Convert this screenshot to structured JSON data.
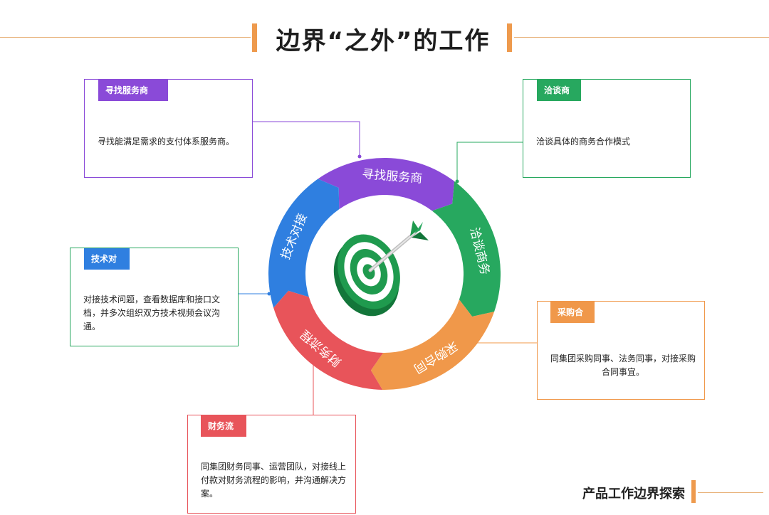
{
  "title": "边界“之外”的工作",
  "footer": "产品工作边界探索",
  "colors": {
    "accent": "#ee9a4d",
    "purple": "#8a4ad8",
    "green": "#27a85f",
    "orange": "#f0984a",
    "red": "#e8545a",
    "blue": "#2f7fe0",
    "target_green": "#1f9a4e"
  },
  "segments": [
    {
      "label": "寻找服务商",
      "color": "#8a4ad8"
    },
    {
      "label": "洽谈商务",
      "color": "#27a85f"
    },
    {
      "label": "采购合同",
      "color": "#f0984a"
    },
    {
      "label": "财务流程",
      "color": "#e8545a"
    },
    {
      "label": "技术对接",
      "color": "#2f7fe0"
    }
  ],
  "cards": [
    {
      "tag": "寻找服务商",
      "text": "寻找能满足需求的支付体系服务商。"
    },
    {
      "tag": "洽谈商务",
      "text": "洽谈具体的商务合作模式"
    },
    {
      "tag": "采购合同",
      "text": "同集团采购同事、法务同事，对接采购合同事宜。"
    },
    {
      "tag": "财务流程",
      "text": "同集团财务同事、运营团队，对接线上付款对财务流程的影响，并沟通解决方案。"
    },
    {
      "tag": "技术对接",
      "text": "对接技术问题，查看数据库和接口文档，并多次组织双方技术视频会议沟通。"
    }
  ],
  "center_icon": "target-with-dart-icon"
}
